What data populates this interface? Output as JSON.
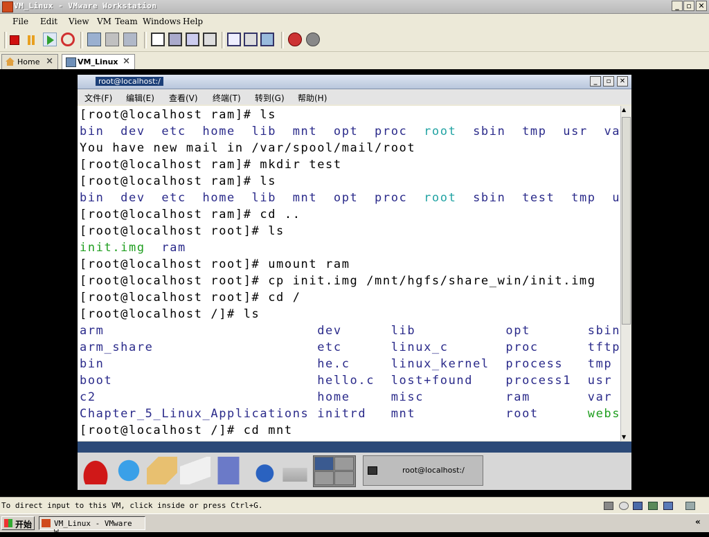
{
  "vmware": {
    "title": "VM_Linux - VMware Workstation",
    "menu": [
      "File",
      "Edit",
      "View",
      "VM",
      "Team",
      "Windows",
      "Help"
    ],
    "tabs": [
      {
        "label": "Home",
        "icon": "home-icon"
      },
      {
        "label": "VM_Linux",
        "icon": "vm-icon"
      }
    ],
    "status_message": "To direct input to this VM, click inside or press Ctrl+G.",
    "accent_color": "#2c4a78"
  },
  "terminal": {
    "title": "root@localhost:/",
    "menu": [
      "文件(F)",
      "编辑(E)",
      "查看(V)",
      "终端(T)",
      "转到(G)",
      "帮助(H)"
    ],
    "lines": [
      [
        {
          "t": "[root@localhost ram]# ls",
          "c": ""
        }
      ],
      [
        {
          "t": "bin  dev  etc  home  lib  mnt  opt  proc  ",
          "c": "blue"
        },
        {
          "t": "root",
          "c": "cyan"
        },
        {
          "t": "  sbin  tmp  usr  var",
          "c": "blue"
        }
      ],
      [
        {
          "t": "You have new mail in /var/spool/mail/root",
          "c": ""
        }
      ],
      [
        {
          "t": "[root@localhost ram]# mkdir test",
          "c": ""
        }
      ],
      [
        {
          "t": "[root@localhost ram]# ls",
          "c": ""
        }
      ],
      [
        {
          "t": "bin  dev  etc  home  lib  mnt  opt  proc  ",
          "c": "blue"
        },
        {
          "t": "root",
          "c": "cyan"
        },
        {
          "t": "  sbin  test  tmp  usr  var",
          "c": "blue"
        }
      ],
      [
        {
          "t": "[root@localhost ram]# cd ..",
          "c": ""
        }
      ],
      [
        {
          "t": "[root@localhost root]# ls",
          "c": ""
        }
      ],
      [
        {
          "t": "init.img",
          "c": "green"
        },
        {
          "t": "  ram",
          "c": "blue"
        }
      ],
      [
        {
          "t": "[root@localhost root]# umount ram",
          "c": ""
        }
      ],
      [
        {
          "t": "[root@localhost root]# cp init.img /mnt/hgfs/share_win/init.img",
          "c": ""
        }
      ],
      [
        {
          "t": "[root@localhost root]# cd /",
          "c": ""
        }
      ],
      [
        {
          "t": "[root@localhost /]# ls",
          "c": ""
        }
      ],
      [
        {
          "t": "arm                          dev      lib           opt       sbin",
          "c": "blue"
        }
      ],
      [
        {
          "t": "arm_share                    etc      linux_c       proc      tftpboot",
          "c": "blue"
        }
      ],
      [
        {
          "t": "bin                          he.c     linux_kernel  process   tmp",
          "c": "blue"
        }
      ],
      [
        {
          "t": "boot                         hello.c  lost+found    process1  usr",
          "c": "blue"
        }
      ],
      [
        {
          "t": "c2                           home     misc          ram       var",
          "c": "blue"
        }
      ],
      [
        {
          "t": "Chapter_5_Linux_Applications initrd   mnt           root      ",
          "c": "blue"
        },
        {
          "t": "webserver.c",
          "c": "green"
        }
      ],
      [
        {
          "t": "[root@localhost /]# cd mnt",
          "c": ""
        }
      ]
    ]
  },
  "panel": {
    "task_label": "root@localhost:/",
    "launchers": [
      "redhat-menu-icon",
      "web-browser-icon",
      "mail-icon",
      "writer-icon",
      "calc-icon",
      "presentation-icon",
      "printer-icon"
    ]
  },
  "taskbar": {
    "start_label": "开始",
    "task_label": "VM_Linux - VMware W..."
  }
}
